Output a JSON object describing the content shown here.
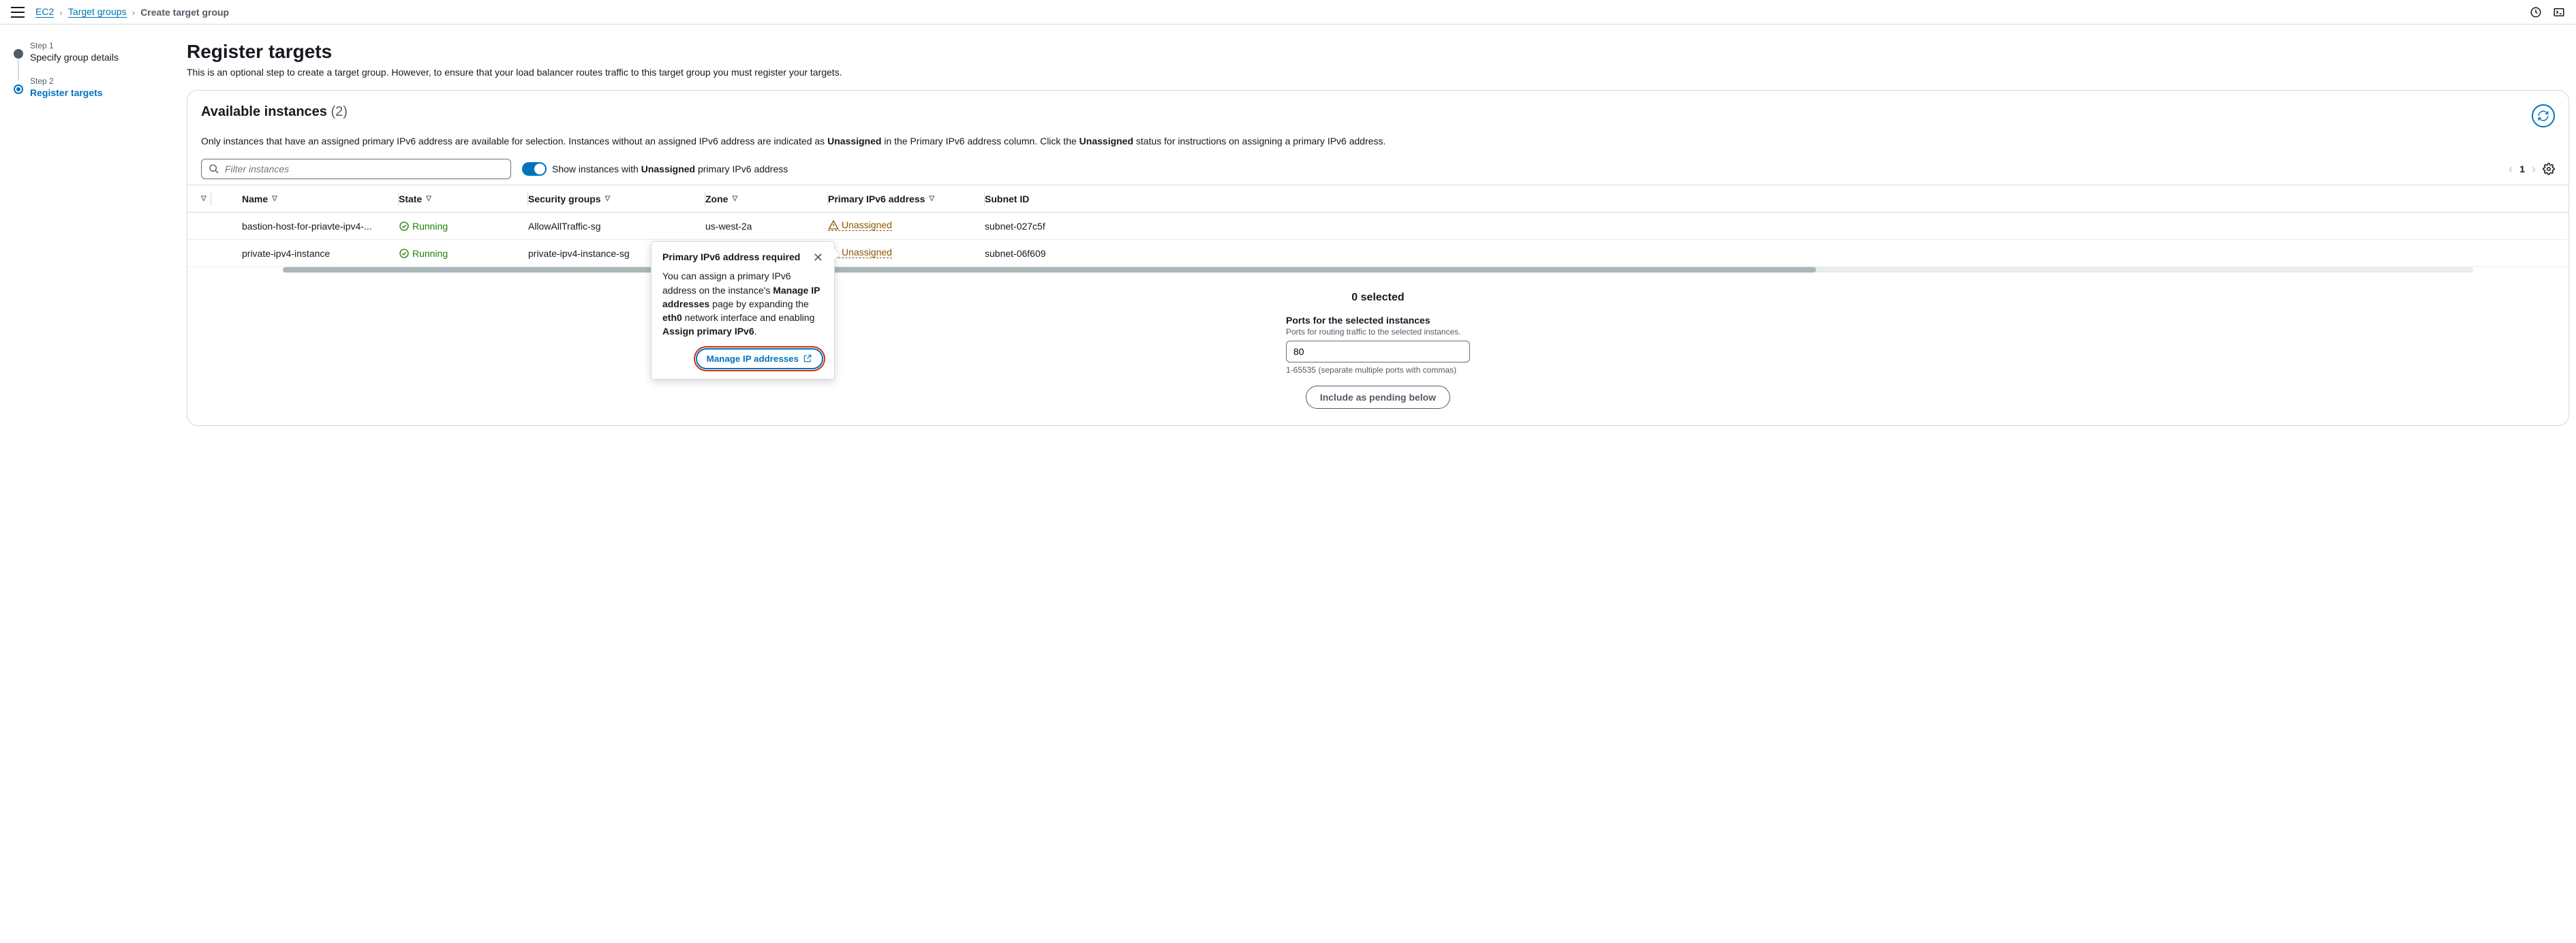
{
  "breadcrumb": {
    "ec2": "EC2",
    "tg": "Target groups",
    "current": "Create target group"
  },
  "steps": {
    "step1_label": "Step 1",
    "step1_title": "Specify group details",
    "step2_label": "Step 2",
    "step2_title": "Register targets"
  },
  "page": {
    "title": "Register targets",
    "desc": "This is an optional step to create a target group. However, to ensure that your load balancer routes traffic to this target group you must register your targets."
  },
  "panel": {
    "title": "Available instances",
    "count": "(2)",
    "note_pre": "Only instances that have an assigned primary IPv6 address are available for selection. Instances without an assigned IPv6 address are indicated as ",
    "note_bold1": "Unassigned",
    "note_mid": " in the Primary IPv6 address column. Click the ",
    "note_bold2": "Unassigned",
    "note_post": " status for instructions on assigning a primary IPv6 address."
  },
  "search": {
    "placeholder": "Filter instances"
  },
  "toggle": {
    "label_pre": "Show instances with ",
    "label_bold": "Unassigned",
    "label_post": " primary IPv6 address"
  },
  "pager": {
    "page": "1"
  },
  "columns": {
    "name": "Name",
    "state": "State",
    "sg": "Security groups",
    "zone": "Zone",
    "pip6": "Primary IPv6 address",
    "subnet": "Subnet ID"
  },
  "rows": [
    {
      "name": "bastion-host-for-priavte-ipv4-...",
      "state": "Running",
      "sg": "AllowAllTraffic-sg",
      "zone": "us-west-2a",
      "pip6": "Unassigned",
      "subnet": "subnet-027c5f"
    },
    {
      "name": "private-ipv4-instance",
      "state": "Running",
      "sg": "private-ipv4-instance-sg",
      "zone": "",
      "pip6": "Unassigned",
      "subnet": "subnet-06f609"
    }
  ],
  "selected": "0 selected",
  "ports": {
    "label": "Ports for the selected instances",
    "sub": "Ports for routing traffic to the selected instances.",
    "value": "80",
    "hint": "1-65535 (separate multiple ports with commas)"
  },
  "pending_btn": "Include as pending below",
  "popover": {
    "title": "Primary IPv6 address required",
    "body_pre": "You can assign a primary IPv6 address on the instance's ",
    "body_b1": "Manage IP addresses",
    "body_mid1": " page by expanding the ",
    "body_b2": "eth0",
    "body_mid2": " network interface and enabling ",
    "body_b3": "Assign primary IPv6",
    "body_post": ".",
    "button": "Manage IP addresses"
  }
}
